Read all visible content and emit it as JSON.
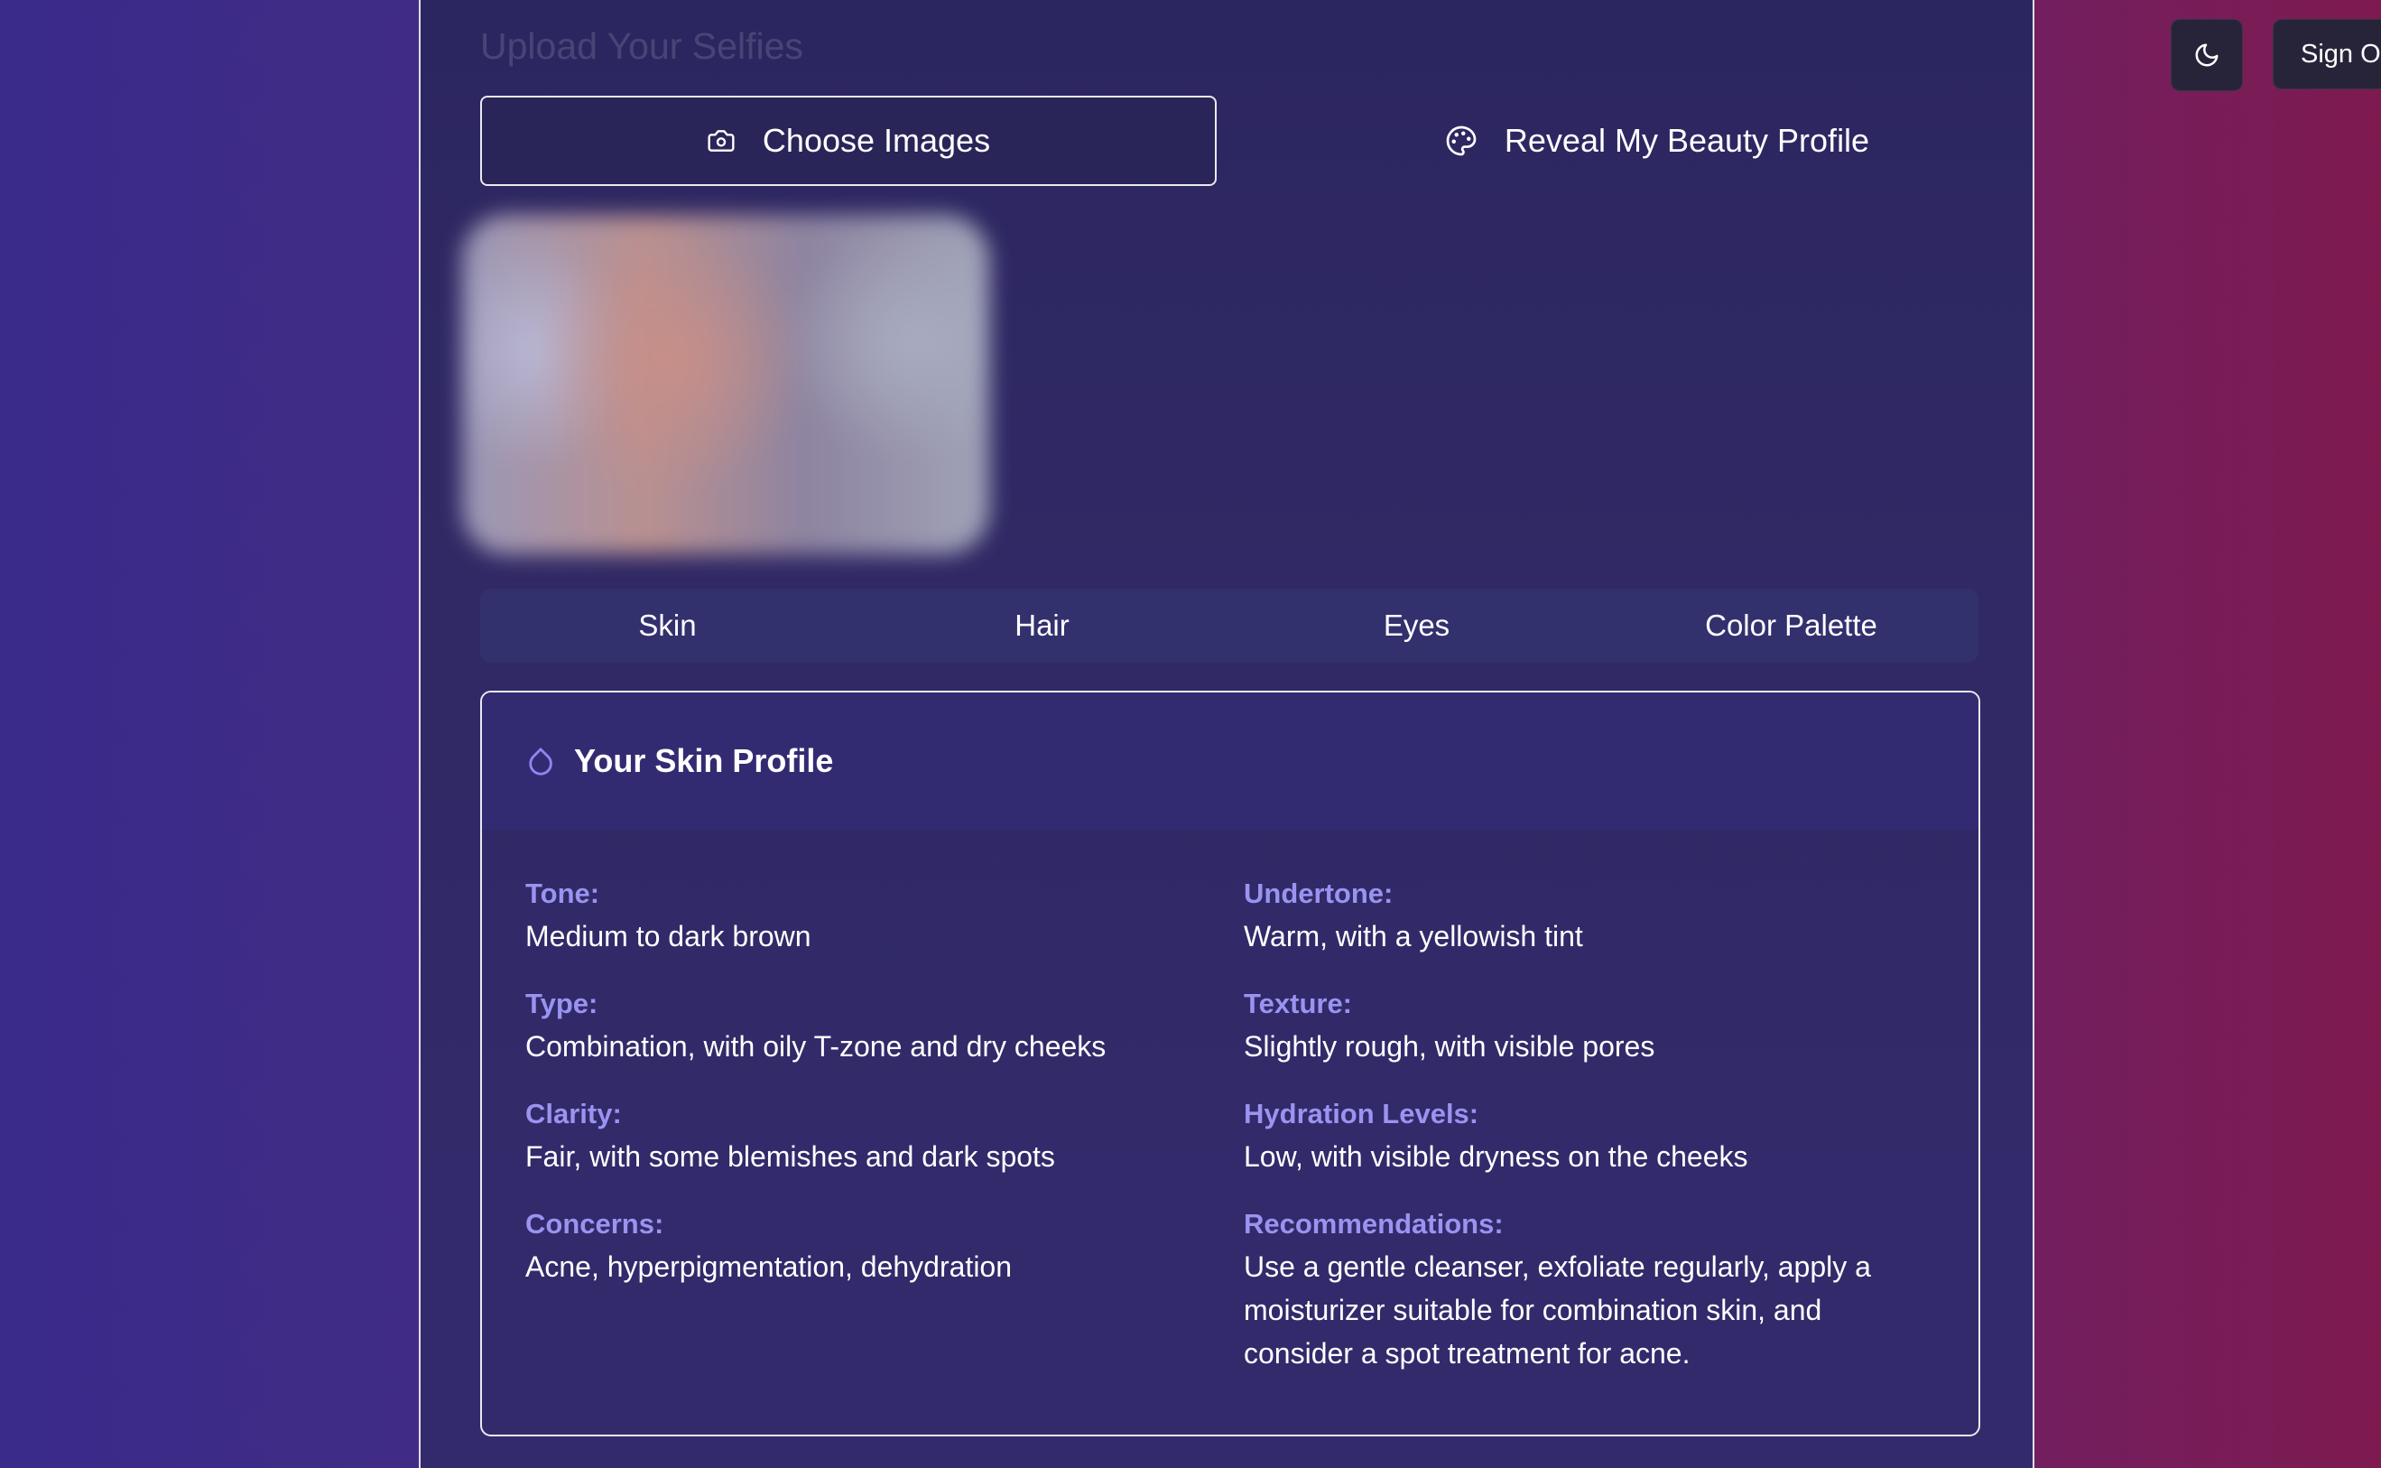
{
  "upload": {
    "title": "Upload Your Selfies",
    "choose_label": "Choose Images",
    "reveal_label": "Reveal My Beauty Profile"
  },
  "tabs": [
    {
      "label": "Skin"
    },
    {
      "label": "Hair"
    },
    {
      "label": "Eyes"
    },
    {
      "label": "Color Palette"
    }
  ],
  "profile": {
    "title": "Your Skin Profile",
    "fields": [
      {
        "label": "Tone:",
        "value": "Medium to dark brown"
      },
      {
        "label": "Undertone:",
        "value": "Warm, with a yellowish tint"
      },
      {
        "label": "Type:",
        "value": "Combination, with oily T-zone and dry cheeks"
      },
      {
        "label": "Texture:",
        "value": "Slightly rough, with visible pores"
      },
      {
        "label": "Clarity:",
        "value": "Fair, with some blemishes and dark spots"
      },
      {
        "label": "Hydration Levels:",
        "value": "Low, with visible dryness on the cheeks"
      },
      {
        "label": "Concerns:",
        "value": "Acne, hyperpigmentation, dehydration"
      },
      {
        "label": "Recommendations:",
        "value": "Use a gentle cleanser, exfoliate regularly, apply a moisturizer suitable for combination skin, and consider a spot treatment for acne."
      }
    ]
  },
  "header": {
    "signout_label": "Sign Out"
  },
  "icons": {
    "camera": "camera-icon",
    "palette": "palette-icon",
    "droplet": "droplet-icon",
    "theme": "moon-icon"
  },
  "colors": {
    "label_accent": "#9a93f0",
    "icon_accent": "#8f86f2",
    "panel_bg": "#2e2862"
  }
}
